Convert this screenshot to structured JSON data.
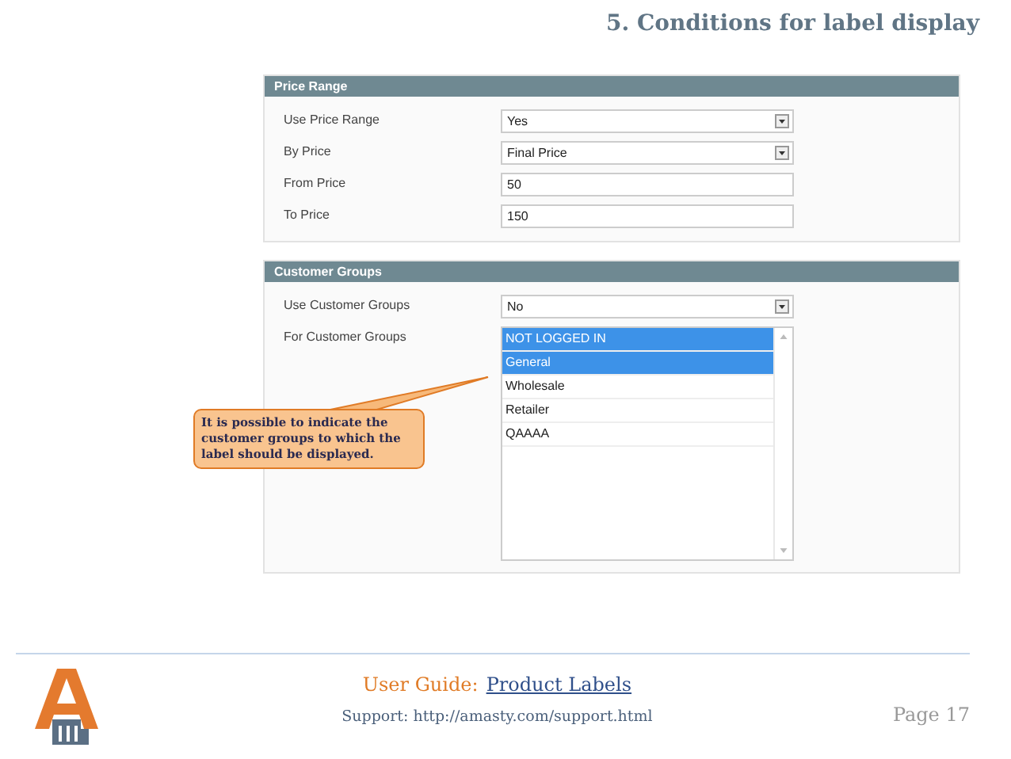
{
  "title": "5. Conditions for label display",
  "sections": [
    {
      "title": "Price Range",
      "fields": [
        {
          "kind": "select",
          "label": "Use Price Range",
          "value": "Yes"
        },
        {
          "kind": "select",
          "label": "By Price",
          "value": "Final Price"
        },
        {
          "kind": "text",
          "label": "From Price",
          "value": "50"
        },
        {
          "kind": "text",
          "label": "To Price",
          "value": "150"
        }
      ]
    },
    {
      "title": "Customer Groups",
      "fields": [
        {
          "kind": "select",
          "label": "Use Customer Groups",
          "value": "No"
        },
        {
          "kind": "multiselect",
          "label": "For Customer Groups",
          "options": [
            {
              "label": "NOT LOGGED IN",
              "selected": true
            },
            {
              "label": "General",
              "selected": true
            },
            {
              "label": "Wholesale",
              "selected": false
            },
            {
              "label": "Retailer",
              "selected": false
            },
            {
              "label": "QAAAA",
              "selected": false
            }
          ]
        }
      ]
    }
  ],
  "callout": "It is possible to indicate the customer groups to which the label should be displayed.",
  "footer": {
    "guide_label": "User Guide:",
    "guide_link": "Product Labels",
    "support": "Support: http://amasty.com/support.html",
    "page": "Page 17"
  }
}
